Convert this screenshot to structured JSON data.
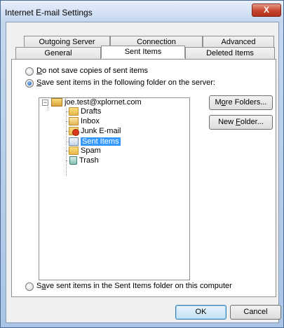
{
  "window": {
    "title": "Internet E-mail Settings",
    "close_label": "X"
  },
  "tabs_row_back": [
    {
      "label": "Outgoing Server"
    },
    {
      "label": "Connection"
    },
    {
      "label": "Advanced"
    }
  ],
  "tabs_row_front": [
    {
      "label": "General"
    },
    {
      "label": "Sent Items",
      "active": true
    },
    {
      "label": "Deleted Items"
    }
  ],
  "options": {
    "do_not_save": {
      "label_mnemonic": "D",
      "label_rest": "o not save copies of sent items",
      "checked": false
    },
    "save_on_server": {
      "label_mnemonic": "S",
      "label_rest": "ave sent items in the following folder on the server:",
      "checked": true
    },
    "save_local": {
      "label_pre": "S",
      "label_mnemonic": "a",
      "label_rest": "ve sent items in the Sent Items folder on this computer",
      "checked": false
    }
  },
  "tree": {
    "account": "joe.test@xplornet.com",
    "folders": [
      {
        "label": "Drafts",
        "icon": "folder-icon"
      },
      {
        "label": "Inbox",
        "icon": "inbox-icon"
      },
      {
        "label": "Junk E-mail",
        "icon": "junk-mail-icon"
      },
      {
        "label": "Sent Items",
        "icon": "sent-items-icon",
        "selected": true
      },
      {
        "label": "Spam",
        "icon": "folder-icon"
      },
      {
        "label": "Trash",
        "icon": "trash-icon"
      }
    ]
  },
  "buttons": {
    "more_folders": {
      "pre": "M",
      "mnemonic": "o",
      "rest": "re Folders..."
    },
    "new_folder": {
      "pre": "New ",
      "mnemonic": "F",
      "rest": "older..."
    },
    "ok": "OK",
    "cancel": "Cancel"
  }
}
